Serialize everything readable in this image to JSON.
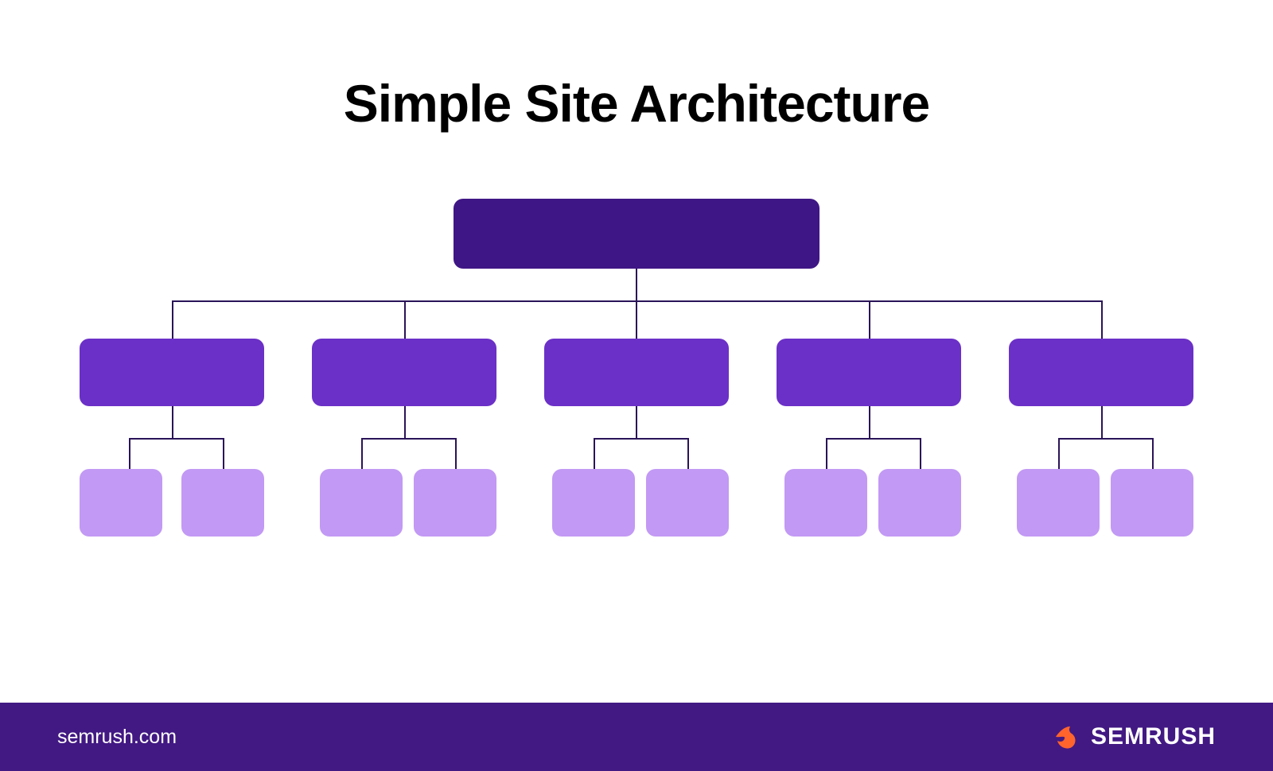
{
  "title": "Simple Site Architecture",
  "footer": {
    "url": "semrush.com",
    "brand": "SEMRUSH"
  },
  "colors": {
    "root": "#3F1685",
    "category": "#6B30C7",
    "leaf": "#C299F4",
    "line": "#2A1458",
    "footer_bg": "#421983",
    "logo_accent": "#FF642D"
  },
  "diagram": {
    "levels": [
      {
        "level": 0,
        "count": 1,
        "label": "root"
      },
      {
        "level": 1,
        "count": 5,
        "label": "category"
      },
      {
        "level": 2,
        "count": 10,
        "label": "leaf"
      }
    ]
  }
}
